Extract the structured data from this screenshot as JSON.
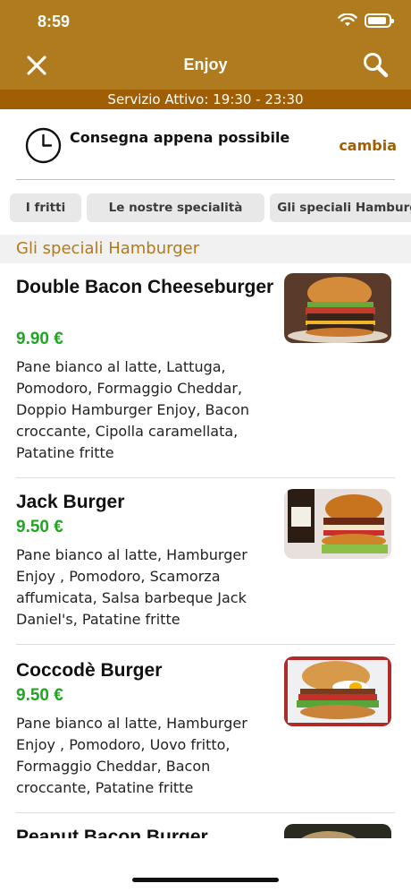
{
  "status_bar": {
    "time": "8:59"
  },
  "header": {
    "title": "Enjoy",
    "close_icon": "close-icon",
    "search_icon": "search-icon"
  },
  "service": {
    "text": "Servizio Attivo: 19:30 - 23:30"
  },
  "delivery": {
    "text": "Consegna appena possibile",
    "change_label": "cambia"
  },
  "tabs": [
    {
      "label": "I fritti"
    },
    {
      "label": "Le nostre specialità"
    },
    {
      "label": "Gli speciali Hamburger"
    }
  ],
  "section": {
    "title": "Gli speciali Hamburger"
  },
  "items": [
    {
      "name": "Double Bacon Cheeseburger",
      "price": "9.90 €",
      "description": "Pane bianco al latte, Lattuga, Pomodoro, Formaggio Cheddar, Doppio Hamburger Enjoy, Bacon croccante, Cipolla caramellata, Patatine fritte"
    },
    {
      "name": "Jack Burger",
      "price": "9.50 €",
      "description": "Pane bianco al latte, Hamburger Enjoy , Pomodoro, Scamorza affumicata, Salsa barbeque Jack Daniel's, Patatine fritte"
    },
    {
      "name": "Coccodè Burger",
      "price": "9.50 €",
      "description": "Pane bianco al latte, Hamburger Enjoy , Pomodoro, Uovo fritto, Formaggio Cheddar, Bacon croccante, Patatine fritte"
    },
    {
      "name": "Peanut Bacon Burger",
      "price": "",
      "description": ""
    }
  ],
  "colors": {
    "header": "#b07a1f",
    "service_bar": "#a05f05",
    "accent": "#a05f05",
    "price": "#1ea81e"
  }
}
